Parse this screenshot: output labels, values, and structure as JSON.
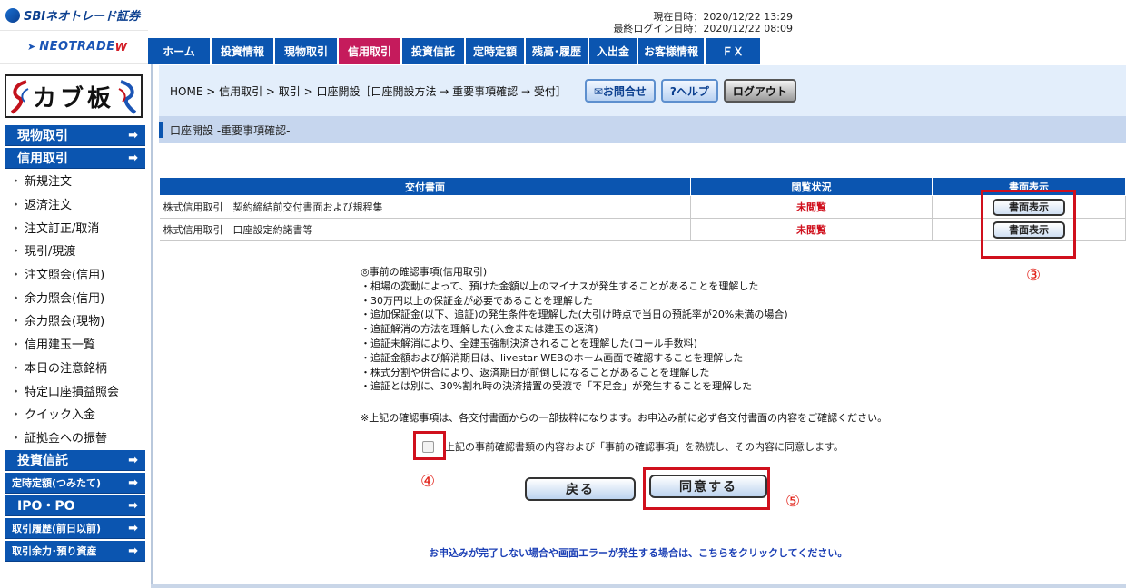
{
  "brand": {
    "sbi": "SBIネオトレード証券",
    "neo": "NEOTRADE",
    "neo_w": "W",
    "kabuita": "カブ板"
  },
  "header": {
    "current_time": "現在日時：2020/12/22 13:29",
    "last_login": "最終ログイン日時：2020/12/22 08:09",
    "tabs": [
      {
        "label": "ホーム",
        "w": 70
      },
      {
        "label": "投資情報",
        "w": 70
      },
      {
        "label": "現物取引",
        "w": 70
      },
      {
        "label": "信用取引",
        "w": 70,
        "active": true
      },
      {
        "label": "投資信託",
        "w": 70
      },
      {
        "label": "定時定額",
        "w": 66
      },
      {
        "label": "残高･履歴",
        "w": 70
      },
      {
        "label": "入出金",
        "w": 54
      },
      {
        "label": "お客様情報",
        "w": 74
      },
      {
        "label": "ＦＸ",
        "w": 62
      }
    ]
  },
  "sidebar": {
    "genbutsu": "現物取引",
    "shinyo": "信用取引",
    "items": [
      "新規注文",
      "返済注文",
      "注文訂正/取消",
      "現引/現渡",
      "注文照会(信用)",
      "余力照会(信用)",
      "余力照会(現物)",
      "信用建玉一覧",
      "本日の注意銘柄",
      "特定口座損益照会",
      "クイック入金",
      "証拠金への振替"
    ],
    "toushin": "投資信託",
    "teiji": "定時定額(つみたて)",
    "ipo": "IPO・PO",
    "rireki": "取引履歴(前日以前)",
    "yoryoku": "取引余力･預り資産",
    "arrow": "➡"
  },
  "breadcrumb": {
    "text": "HOME > 信用取引 > 取引 > 口座開設［口座開設方法 → 重要事項確認 → 受付］",
    "inquiry": "✉お問合せ",
    "help": "?ヘルプ",
    "logout": "ログアウト"
  },
  "section_title": "口座開設 -重要事項確認-",
  "table": {
    "headers": [
      "交付書面",
      "閲覧状況",
      "書面表示"
    ],
    "rows": [
      {
        "name": "株式信用取引　契約締結前交付書面および規程集",
        "status": "未閲覧",
        "button": "書面表示"
      },
      {
        "name": "株式信用取引　口座設定約諾書等",
        "status": "未閲覧",
        "button": "書面表示"
      }
    ]
  },
  "notes": [
    "◎事前の確認事項(信用取引)",
    "・相場の変動によって、預けた金額以上のマイナスが発生することがあることを理解した",
    "・30万円以上の保証金が必要であることを理解した",
    "・追加保証金(以下、追証)の発生条件を理解した(大引け時点で当日の預託率が20%未満の場合)",
    "・追証解消の方法を理解した(入金または建玉の返済)",
    "・追証未解消により、全建玉強制決済されることを理解した(コール手数料)",
    "・追証金額および解消期日は、livestar WEBのホーム画面で確認することを理解した",
    "・株式分割や併合により、返済期日が前倒しになることがあることを理解した",
    "・追証とは別に、30%割れ時の決済措置の受渡で「不足金」が発生することを理解した"
  ],
  "footnote": "※上記の確認事項は、各交付書面からの一部抜粋になります。お申込み前に必ず各交付書面の内容をご確認ください。",
  "agree_text": "上記の事前確認書類の内容および「事前の確認事項」を熟読し、その内容に同意します。",
  "buttons": {
    "back": "戻る",
    "agree": "同意する"
  },
  "markers": {
    "three": "③",
    "four": "④",
    "five": "⑤"
  },
  "error_link": "お申込みが完了しない場合や画面エラーが発生する場合は、こちらをクリックしてください。",
  "colors": {
    "primary": "#0b55b0",
    "active_tab": "#c51b5c",
    "highlight": "#d0101d"
  }
}
